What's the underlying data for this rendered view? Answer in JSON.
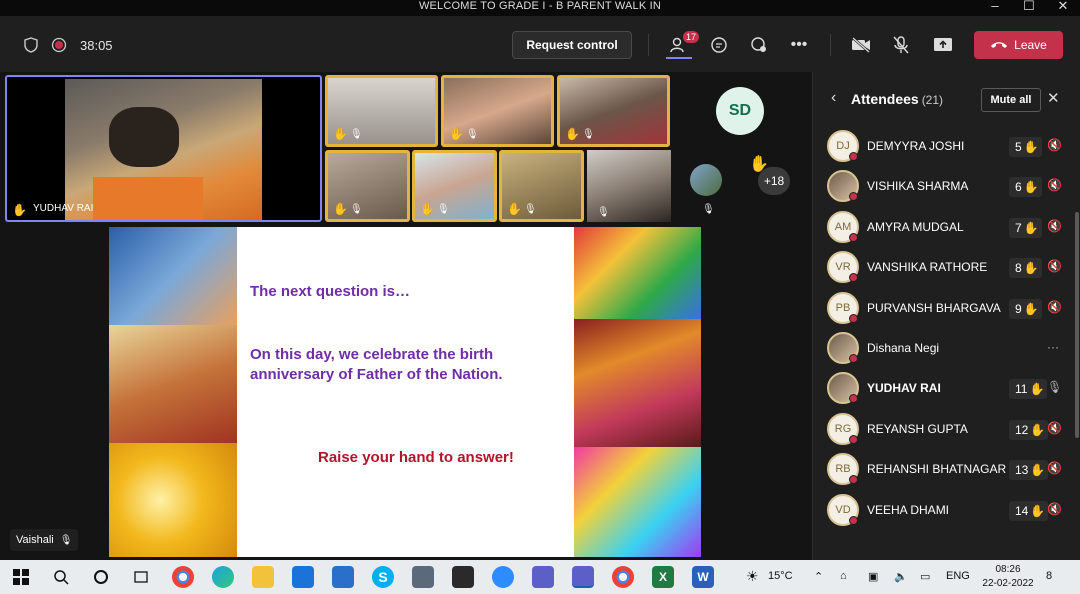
{
  "window": {
    "title": "WELCOME TO GRADE I - B PARENT WALK IN"
  },
  "toolbar": {
    "timer": "38:05",
    "request_control": "Request control",
    "people_badge": "17",
    "leave": "Leave"
  },
  "stage": {
    "main_tile_name": "YUDHAV RAI",
    "sd_initials": "SD",
    "overflow_count": "+18",
    "self_name": "Vaishali"
  },
  "slide": {
    "line1": "The next question is…",
    "line2": "On this day, we celebrate the birth anniversary of Father of the Nation.",
    "line3": "Raise your hand to answer!"
  },
  "panel": {
    "title": "Attendees",
    "count": "(21)",
    "mute_all": "Mute all",
    "attendees": [
      {
        "initials": "DJ",
        "name": "DEMYYRA JOSHI",
        "hand": "5",
        "photo": false,
        "bold": false
      },
      {
        "initials": "",
        "name": "VISHIKA SHARMA",
        "hand": "6",
        "photo": true,
        "bold": false
      },
      {
        "initials": "AM",
        "name": "AMYRA MUDGAL",
        "hand": "7",
        "photo": false,
        "bold": false
      },
      {
        "initials": "VR",
        "name": "VANSHIKA RATHORE",
        "hand": "8",
        "photo": false,
        "bold": false
      },
      {
        "initials": "PB",
        "name": "PURVANSH BHARGAVA",
        "hand": "9",
        "photo": false,
        "bold": false
      },
      {
        "initials": "",
        "name": "Dishana Negi",
        "hand": "",
        "photo": true,
        "bold": false
      },
      {
        "initials": "",
        "name": "YUDHAV RAI",
        "hand": "11",
        "photo": true,
        "bold": true
      },
      {
        "initials": "RG",
        "name": "REYANSH GUPTA",
        "hand": "12",
        "photo": false,
        "bold": false
      },
      {
        "initials": "RB",
        "name": "REHANSHI BHATNAGAR",
        "hand": "13",
        "photo": false,
        "bold": false
      },
      {
        "initials": "VD",
        "name": "VEEHA DHAMI",
        "hand": "14",
        "photo": false,
        "bold": false
      }
    ]
  },
  "taskbar": {
    "weather": "15°C",
    "lang": "ENG",
    "time": "08:26",
    "date": "22-02-2022",
    "notif_count": "8"
  },
  "colors": {
    "accent": "#7f85f5",
    "leave": "#c4314b",
    "hand_border": "#e3b540"
  }
}
